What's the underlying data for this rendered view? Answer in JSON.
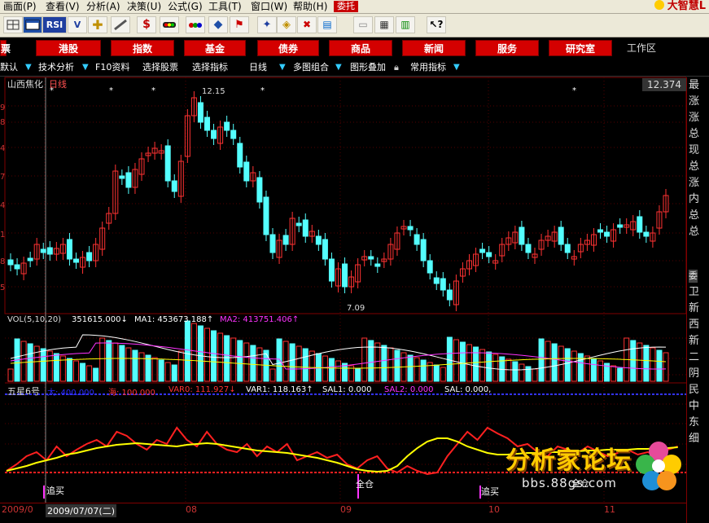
{
  "menu": {
    "items": [
      "画面(P)",
      "查看(V)",
      "分析(A)",
      "决策(U)",
      "公式(G)",
      "工具(T)",
      "窗口(W)",
      "帮助(H)"
    ],
    "weituo": "委托",
    "brand": "大智慧L"
  },
  "toolbar": {
    "icons": [
      "grid-icon",
      "window-icon",
      "rsi-icon",
      "v-icon",
      "cross-cursor-icon",
      "ruler-icon",
      "dollar-icon",
      "traffic-light-icon",
      "dots-icon",
      "diamond-icon",
      "flag-icon",
      "star-icon",
      "search-icon",
      "tool-icon",
      "book-icon",
      "note-icon",
      "board-icon",
      "books-icon",
      "help-cursor-icon"
    ],
    "rsi": "RSI",
    "dollar": "$"
  },
  "nav": {
    "items": [
      "票",
      "港股",
      "指数",
      "基金",
      "债券",
      "商品",
      "新闻",
      "服务",
      "研究室"
    ],
    "work": "工作区"
  },
  "tabs": {
    "items": [
      "默认",
      "技术分析",
      "F10资料",
      "选择股票",
      "选择指标",
      "日线",
      "多图组合",
      "图形叠加",
      "常用指标"
    ]
  },
  "chart_header": {
    "stock": "山西焦化",
    "period": "日线",
    "price_box": "12.374"
  },
  "price_axis": {
    "ticks": [
      "9",
      "8",
      "4",
      "7",
      "4",
      "1",
      "8",
      "5"
    ]
  },
  "annotations": {
    "high": "12.15",
    "low": "7.09"
  },
  "vol": {
    "label": "VOL(5,10,20)",
    "v1": "351615.000↓",
    "ma1": "MA1: 453673.188↑",
    "ma2": "MA2: 413751.406↑"
  },
  "ind": {
    "name": "五星6号",
    "da": "大: 400.000",
    "hai": "海: 100.000",
    "var0": "VAR0: 111.927↓",
    "var1": "VAR1: 118.163↑",
    "sal1": "SAL1: 0.000",
    "sal2": "SAL2: 0.000",
    "sal": "SAL: 0.000,",
    "signals": [
      "追买",
      "全仓",
      "追买"
    ],
    "signal_extra": "全仓"
  },
  "dates": [
    "2009/0",
    "2009/07/07(二)",
    "08",
    "09",
    "10",
    "11"
  ],
  "right_panel": [
    "最",
    "涨",
    "涨",
    "总",
    "现",
    "总",
    "涨",
    "内",
    "总",
    "总",
    "委",
    "卫",
    "新",
    "西",
    "新",
    "二",
    "阴",
    "民",
    "中",
    "东",
    "细"
  ],
  "watermark": {
    "title": "分析家论坛",
    "url": "bbs.88gs.com"
  },
  "chart_data": {
    "type": "candlestick",
    "title": "山西焦化 日线",
    "annotated_high": 12.15,
    "annotated_low": 7.09,
    "last": 12.374
  },
  "colors": {
    "up": "#ff3232",
    "down": "#54ffff",
    "ma1": "#ffffff",
    "ma2": "#ff33ff",
    "ma3": "#ffff00",
    "brand": "#c00000"
  }
}
